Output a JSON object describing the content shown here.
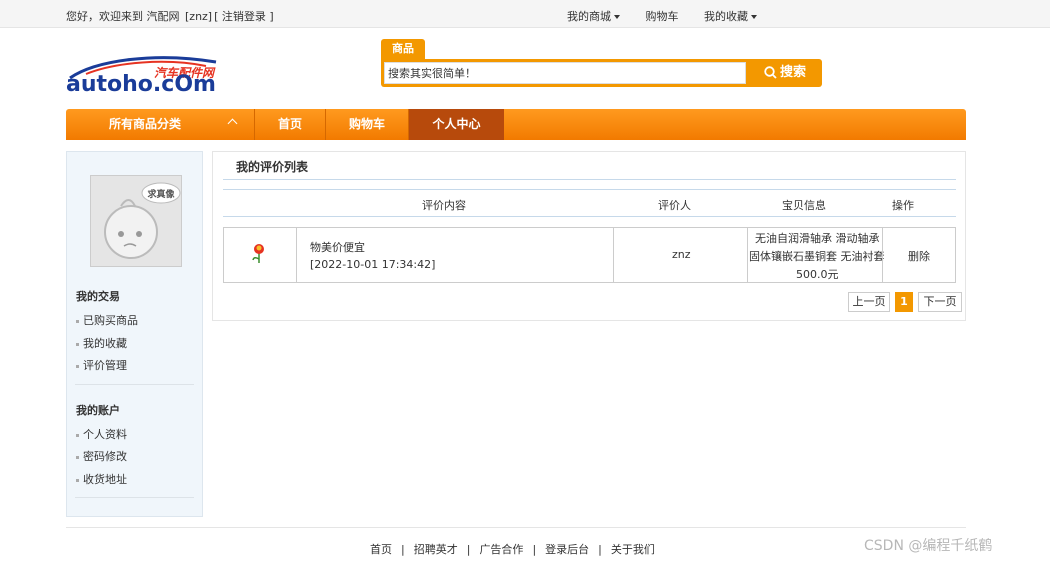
{
  "topbar": {
    "welcome_prefix": "您好，欢迎来到 汽配网",
    "username_bracket": "[znz]",
    "logout": "[ 注销登录 ]",
    "links": [
      {
        "label": "我的商城",
        "caret": true
      },
      {
        "label": "购物车",
        "caret": false
      },
      {
        "label": "我的收藏",
        "caret": true
      }
    ]
  },
  "logo": {
    "brand": "autoho.cOm",
    "cn": "汽车配件网"
  },
  "search": {
    "tab": "商品",
    "value": "搜索其实很简单！",
    "button": "搜索"
  },
  "nav": {
    "all_categories": "所有商品分类",
    "items": [
      "首页",
      "购物车",
      "个人中心"
    ],
    "active_index": 2
  },
  "sidebar": {
    "avatar_text": "求真像",
    "sections": [
      {
        "title": "我的交易",
        "items": [
          "已购买商品",
          "我的收藏",
          "评价管理"
        ]
      },
      {
        "title": "我的账户",
        "items": [
          "个人资料",
          "密码修改",
          "收货地址"
        ]
      }
    ]
  },
  "main": {
    "title": "我的评价列表",
    "columns": [
      "评价内容",
      "评价人",
      "宝贝信息",
      "操作"
    ],
    "rows": [
      {
        "comment": "物美价便宜",
        "time": "[2022-10-01 17:34:42]",
        "reviewer": "znz",
        "product_lines": [
          "无油自润滑轴承 滑动轴承",
          "固体镶嵌石墨铜套 无油衬套",
          "500.0元"
        ],
        "action": "删除"
      }
    ],
    "pager": {
      "prev": "上一页",
      "current": "1",
      "next": "下一页"
    }
  },
  "footer": {
    "links": [
      "首页",
      "招聘英才",
      "广告合作",
      "登录后台",
      "关于我们"
    ],
    "separator": "|"
  },
  "watermark": "CSDN @编程千纸鹤"
}
